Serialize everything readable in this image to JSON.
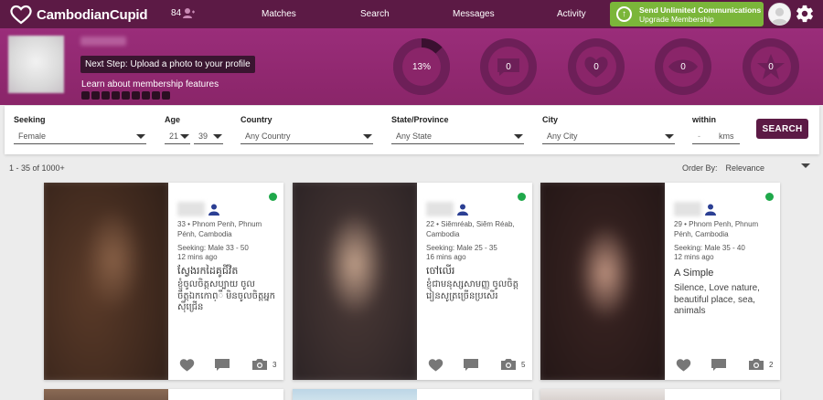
{
  "app": {
    "name": "CambodianCupid"
  },
  "topnav": {
    "notification_count": "84",
    "links": [
      "Matches",
      "Search",
      "Messages",
      "Activity"
    ],
    "upgrade_title": "Send Unlimited Communications",
    "upgrade_sub": "Upgrade Membership"
  },
  "profile_band": {
    "next_step": "Next Step: Upload a photo to your profile",
    "learn_link": "Learn about membership features",
    "stats": [
      {
        "icon": "progress-ring",
        "value": "13%"
      },
      {
        "icon": "message-icon",
        "value": "0"
      },
      {
        "icon": "heart-icon",
        "value": "0"
      },
      {
        "icon": "eye-icon",
        "value": "0"
      },
      {
        "icon": "star-icon",
        "value": "0"
      }
    ],
    "completion_percent": 13
  },
  "search": {
    "seeking_label": "Seeking",
    "seeking_value": "Female",
    "age_label": "Age",
    "age_min": "21",
    "age_max": "39",
    "country_label": "Country",
    "country_value": "Any Country",
    "state_label": "State/Province",
    "state_value": "Any State",
    "city_label": "City",
    "city_value": "Any City",
    "within_label": "within",
    "within_value": "-",
    "within_unit": "kms",
    "button": "SEARCH"
  },
  "results": {
    "count_text": "1 - 35 of 1000+",
    "order_by_label": "Order By:",
    "order_by_value": "Relevance"
  },
  "cards": [
    {
      "location": "33 • Phnom Penh, Phnum Pénh, Cambodia",
      "seeking": "Seeking: Male 33 - 50",
      "ago": "12 mins ago",
      "headline": "ស្វែងរកដៃគូជីវិត",
      "about": "ខ្ញុំចូលចិត្តសប្បាយ ចូលចិត្តឯកកោព្ឹ មិនចូលចិត្តអ្នកស៊ីជ្រើន",
      "photo_count": "3"
    },
    {
      "location": "22 • Siĕmréab, Siĕm Réab, Cambodia",
      "seeking": "Seeking: Male 25 - 35",
      "ago": "16 mins ago",
      "headline": "ចៅលើរ",
      "about": "ខ្ញុំជាមនុស្សសាមញ្ញ ចូលចិត្តរៀនសូត្រច្រើនប្រសើរ​",
      "photo_count": "5"
    },
    {
      "location": "29 • Phnom Penh, Phnum Pénh, Cambodia",
      "seeking": "Seeking: Male 35 - 40",
      "ago": "12 mins ago",
      "headline": "A Simple",
      "about": "Silence, Love nature, beautiful place, sea, animals",
      "photo_count": "2"
    }
  ]
}
